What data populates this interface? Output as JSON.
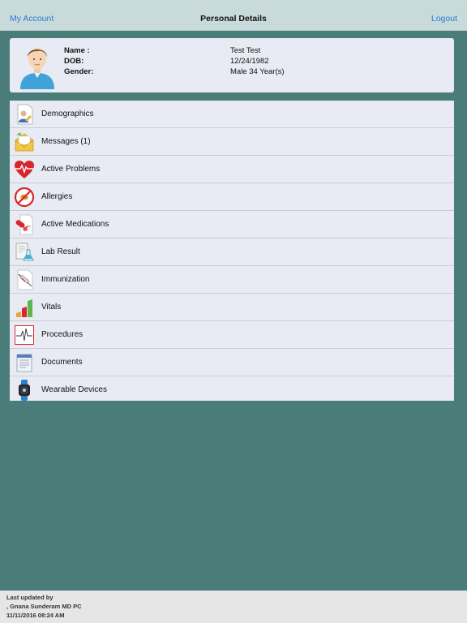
{
  "nav": {
    "left_label": "My Account",
    "title": "Personal Details",
    "right_label": "Logout"
  },
  "profile": {
    "name_label": "Name :",
    "dob_label": "DOB:",
    "gender_label": "Gender:",
    "name_value": "Test Test",
    "dob_value": "12/24/1982",
    "gender_value": "Male 34 Year(s)"
  },
  "menu": {
    "items": [
      {
        "label": "Demographics",
        "icon": "demographics-icon"
      },
      {
        "label": "Messages (1)",
        "icon": "messages-icon"
      },
      {
        "label": "Active Problems",
        "icon": "heart-icon"
      },
      {
        "label": "Allergies",
        "icon": "allergy-icon"
      },
      {
        "label": "Active Medications",
        "icon": "pills-icon"
      },
      {
        "label": "Lab Result",
        "icon": "flask-icon"
      },
      {
        "label": "Immunization",
        "icon": "syringe-icon"
      },
      {
        "label": "Vitals",
        "icon": "bar-chart-icon"
      },
      {
        "label": "Procedures",
        "icon": "ecg-icon"
      },
      {
        "label": "Documents",
        "icon": "document-icon"
      },
      {
        "label": "Wearable Devices",
        "icon": "smartwatch-icon"
      }
    ]
  },
  "footer": {
    "line1": "Last updated by",
    "line2": ", Gnana Sunderam MD PC",
    "line3": "11/11/2016 08:24 AM"
  },
  "colors": {
    "background": "#4a7d7a",
    "navbar": "#c9dadb",
    "link": "#2a7ad2",
    "card": "#e8ebf3"
  }
}
